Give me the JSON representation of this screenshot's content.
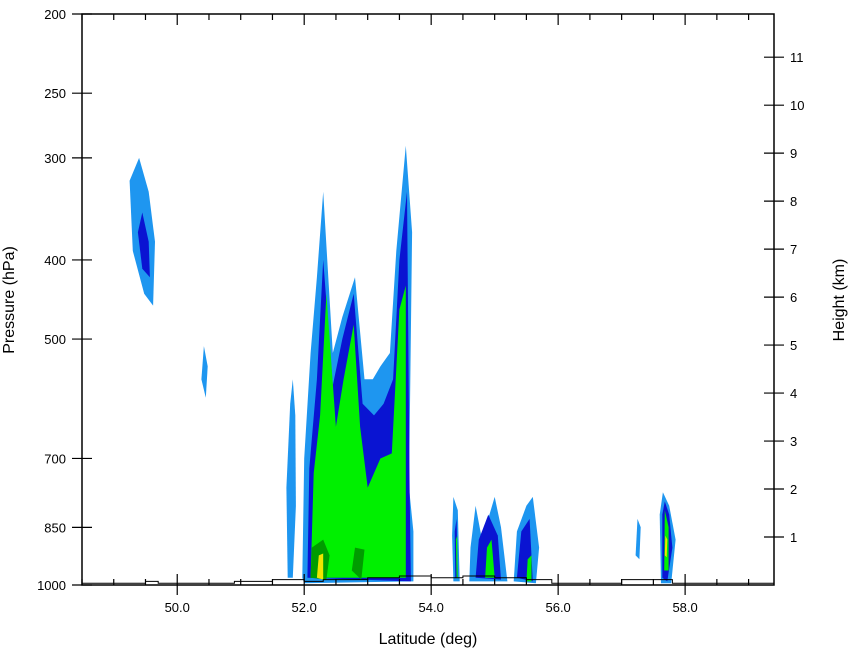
{
  "chart_data": {
    "type": "contour-cross-section",
    "title": "",
    "xlabel": "Latitude (deg)",
    "ylabel_left": "Pressure (hPa)",
    "ylabel_right": "Height (km)",
    "xlim": [
      48.5,
      59.4
    ],
    "ylim_pressure": [
      1000,
      200
    ],
    "x_scale": "linear",
    "y_scale": "log-pressure",
    "x_ticks": [
      {
        "value": 50,
        "label": "50.0"
      },
      {
        "value": 52,
        "label": "52.0"
      },
      {
        "value": 54,
        "label": "54.0"
      },
      {
        "value": 56,
        "label": "56.0"
      },
      {
        "value": 58,
        "label": "58.0"
      }
    ],
    "x_minor_step": 0.5,
    "y_left_ticks": [
      {
        "value": 200,
        "label": "200"
      },
      {
        "value": 250,
        "label": "250"
      },
      {
        "value": 300,
        "label": "300"
      },
      {
        "value": 400,
        "label": "400"
      },
      {
        "value": 500,
        "label": "500"
      },
      {
        "value": 700,
        "label": "700"
      },
      {
        "value": 850,
        "label": "850"
      },
      {
        "value": 1000,
        "label": "1000"
      }
    ],
    "y_right_ticks": [
      {
        "value": 1,
        "label": "1"
      },
      {
        "value": 2,
        "label": "2"
      },
      {
        "value": 3,
        "label": "3"
      },
      {
        "value": 4,
        "label": "4"
      },
      {
        "value": 5,
        "label": "5"
      },
      {
        "value": 6,
        "label": "6"
      },
      {
        "value": 7,
        "label": "7"
      },
      {
        "value": 8,
        "label": "8"
      },
      {
        "value": 9,
        "label": "9"
      },
      {
        "value": 10,
        "label": "10"
      },
      {
        "value": 11,
        "label": "11"
      }
    ],
    "levels": [
      {
        "name": "level-1",
        "color": "#1e96f0"
      },
      {
        "name": "level-2",
        "color": "#0a14d2"
      },
      {
        "name": "level-3",
        "color": "#00f000"
      },
      {
        "name": "level-4",
        "color": "#009c00"
      },
      {
        "name": "level-5",
        "color": "#f0e600"
      }
    ],
    "terrain": [
      [
        48.5,
        995
      ],
      [
        49.5,
        995
      ],
      [
        49.5,
        990
      ],
      [
        49.7,
        990
      ],
      [
        49.7,
        995
      ],
      [
        50.9,
        995
      ],
      [
        50.9,
        990
      ],
      [
        51.5,
        990
      ],
      [
        51.5,
        985
      ],
      [
        52.0,
        985
      ],
      [
        52.0,
        990
      ],
      [
        52.3,
        990
      ],
      [
        52.3,
        985
      ],
      [
        53.0,
        985
      ],
      [
        53.0,
        980
      ],
      [
        53.5,
        980
      ],
      [
        53.5,
        975
      ],
      [
        54.0,
        975
      ],
      [
        54.0,
        980
      ],
      [
        54.5,
        980
      ],
      [
        54.5,
        975
      ],
      [
        55.0,
        975
      ],
      [
        55.0,
        980
      ],
      [
        55.5,
        980
      ],
      [
        55.5,
        985
      ],
      [
        55.9,
        985
      ],
      [
        55.9,
        995
      ],
      [
        57.0,
        995
      ],
      [
        57.0,
        985
      ],
      [
        57.8,
        985
      ],
      [
        57.8,
        995
      ],
      [
        59.4,
        995
      ]
    ],
    "blobs": [
      {
        "level": 1,
        "points": [
          [
            49.4,
            300
          ],
          [
            49.55,
            330
          ],
          [
            49.65,
            380
          ],
          [
            49.62,
            455
          ],
          [
            49.48,
            440
          ],
          [
            49.3,
            390
          ],
          [
            49.25,
            320
          ]
        ]
      },
      {
        "level": 2,
        "points": [
          [
            49.45,
            350
          ],
          [
            49.55,
            380
          ],
          [
            49.57,
            420
          ],
          [
            49.45,
            410
          ],
          [
            49.38,
            370
          ]
        ]
      },
      {
        "level": 1,
        "points": [
          [
            50.42,
            510
          ],
          [
            50.48,
            540
          ],
          [
            50.45,
            590
          ],
          [
            50.38,
            560
          ]
        ]
      },
      {
        "level": 1,
        "points": [
          [
            51.82,
            560
          ],
          [
            51.86,
            620
          ],
          [
            51.87,
            800
          ],
          [
            51.82,
            980
          ],
          [
            51.74,
            980
          ],
          [
            51.72,
            760
          ],
          [
            51.78,
            600
          ]
        ]
      },
      {
        "level": 1,
        "points": [
          [
            51.97,
            980
          ],
          [
            52.0,
            700
          ],
          [
            52.1,
            520
          ],
          [
            52.2,
            420
          ],
          [
            52.3,
            330
          ],
          [
            52.45,
            520
          ],
          [
            52.6,
            470
          ],
          [
            52.8,
            420
          ],
          [
            52.95,
            560
          ],
          [
            53.08,
            560
          ],
          [
            53.2,
            540
          ],
          [
            53.35,
            520
          ],
          [
            53.45,
            390
          ],
          [
            53.6,
            290
          ],
          [
            53.7,
            370
          ],
          [
            53.65,
            760
          ],
          [
            53.72,
            860
          ],
          [
            53.72,
            990
          ],
          [
            52.0,
            995
          ]
        ]
      },
      {
        "level": 2,
        "points": [
          [
            52.05,
            980
          ],
          [
            52.08,
            720
          ],
          [
            52.2,
            560
          ],
          [
            52.3,
            400
          ],
          [
            52.45,
            570
          ],
          [
            52.6,
            500
          ],
          [
            52.78,
            440
          ],
          [
            52.92,
            600
          ],
          [
            53.1,
            620
          ],
          [
            53.25,
            600
          ],
          [
            53.4,
            560
          ],
          [
            53.5,
            400
          ],
          [
            53.62,
            330
          ],
          [
            53.66,
            760
          ],
          [
            53.68,
            990
          ]
        ]
      },
      {
        "level": 3,
        "points": [
          [
            52.1,
            980
          ],
          [
            52.15,
            730
          ],
          [
            52.25,
            620
          ],
          [
            52.35,
            440
          ],
          [
            52.5,
            640
          ],
          [
            52.62,
            560
          ],
          [
            52.78,
            480
          ],
          [
            52.88,
            640
          ],
          [
            53.0,
            760
          ],
          [
            53.2,
            700
          ],
          [
            53.38,
            690
          ],
          [
            53.5,
            460
          ],
          [
            53.6,
            430
          ],
          [
            53.6,
            980
          ]
        ]
      },
      {
        "level": 4,
        "points": [
          [
            52.1,
            980
          ],
          [
            52.12,
            900
          ],
          [
            52.3,
            880
          ],
          [
            52.4,
            920
          ],
          [
            52.35,
            985
          ]
        ]
      },
      {
        "level": 4,
        "points": [
          [
            52.75,
            960
          ],
          [
            52.8,
            900
          ],
          [
            52.95,
            905
          ],
          [
            52.9,
            985
          ]
        ]
      },
      {
        "level": 5,
        "points": [
          [
            52.2,
            980
          ],
          [
            52.23,
            920
          ],
          [
            52.3,
            915
          ],
          [
            52.3,
            985
          ]
        ]
      },
      {
        "level": 1,
        "points": [
          [
            54.35,
            990
          ],
          [
            54.33,
            870
          ],
          [
            54.35,
            780
          ],
          [
            54.42,
            810
          ],
          [
            54.45,
            990
          ]
        ]
      },
      {
        "level": 2,
        "points": [
          [
            54.38,
            980
          ],
          [
            54.37,
            860
          ],
          [
            54.4,
            830
          ],
          [
            54.42,
            980
          ]
        ]
      },
      {
        "level": 3,
        "points": [
          [
            54.4,
            980
          ],
          [
            54.39,
            880
          ],
          [
            54.41,
            870
          ],
          [
            54.42,
            980
          ]
        ]
      },
      {
        "level": 1,
        "points": [
          [
            54.6,
            990
          ],
          [
            54.62,
            900
          ],
          [
            54.7,
            800
          ],
          [
            54.8,
            880
          ],
          [
            55.0,
            780
          ],
          [
            55.1,
            850
          ],
          [
            55.2,
            990
          ]
        ]
      },
      {
        "level": 2,
        "points": [
          [
            54.7,
            980
          ],
          [
            54.75,
            880
          ],
          [
            54.9,
            820
          ],
          [
            55.05,
            870
          ],
          [
            55.1,
            985
          ]
        ]
      },
      {
        "level": 3,
        "points": [
          [
            54.85,
            980
          ],
          [
            54.88,
            900
          ],
          [
            54.95,
            880
          ],
          [
            55.0,
            980
          ]
        ]
      },
      {
        "level": 1,
        "points": [
          [
            55.3,
            990
          ],
          [
            55.35,
            860
          ],
          [
            55.5,
            800
          ],
          [
            55.6,
            780
          ],
          [
            55.7,
            900
          ],
          [
            55.65,
            995
          ]
        ]
      },
      {
        "level": 2,
        "points": [
          [
            55.35,
            980
          ],
          [
            55.42,
            860
          ],
          [
            55.55,
            830
          ],
          [
            55.6,
            990
          ]
        ]
      },
      {
        "level": 3,
        "points": [
          [
            55.5,
            990
          ],
          [
            55.52,
            930
          ],
          [
            55.58,
            920
          ],
          [
            55.58,
            990
          ]
        ]
      },
      {
        "level": 1,
        "points": [
          [
            57.25,
            830
          ],
          [
            57.3,
            850
          ],
          [
            57.28,
            930
          ],
          [
            57.22,
            920
          ]
        ]
      },
      {
        "level": 1,
        "points": [
          [
            57.65,
            770
          ],
          [
            57.75,
            800
          ],
          [
            57.85,
            880
          ],
          [
            57.78,
            995
          ],
          [
            57.62,
            995
          ],
          [
            57.6,
            820
          ]
        ]
      },
      {
        "level": 2,
        "points": [
          [
            57.68,
            790
          ],
          [
            57.75,
            820
          ],
          [
            57.8,
            900
          ],
          [
            57.72,
            990
          ],
          [
            57.64,
            980
          ],
          [
            57.64,
            820
          ]
        ]
      },
      {
        "level": 3,
        "points": [
          [
            57.68,
            810
          ],
          [
            57.74,
            850
          ],
          [
            57.74,
            960
          ],
          [
            57.67,
            960
          ]
        ]
      },
      {
        "level": 5,
        "points": [
          [
            57.69,
            870
          ],
          [
            57.72,
            880
          ],
          [
            57.71,
            925
          ],
          [
            57.68,
            920
          ]
        ]
      }
    ]
  }
}
